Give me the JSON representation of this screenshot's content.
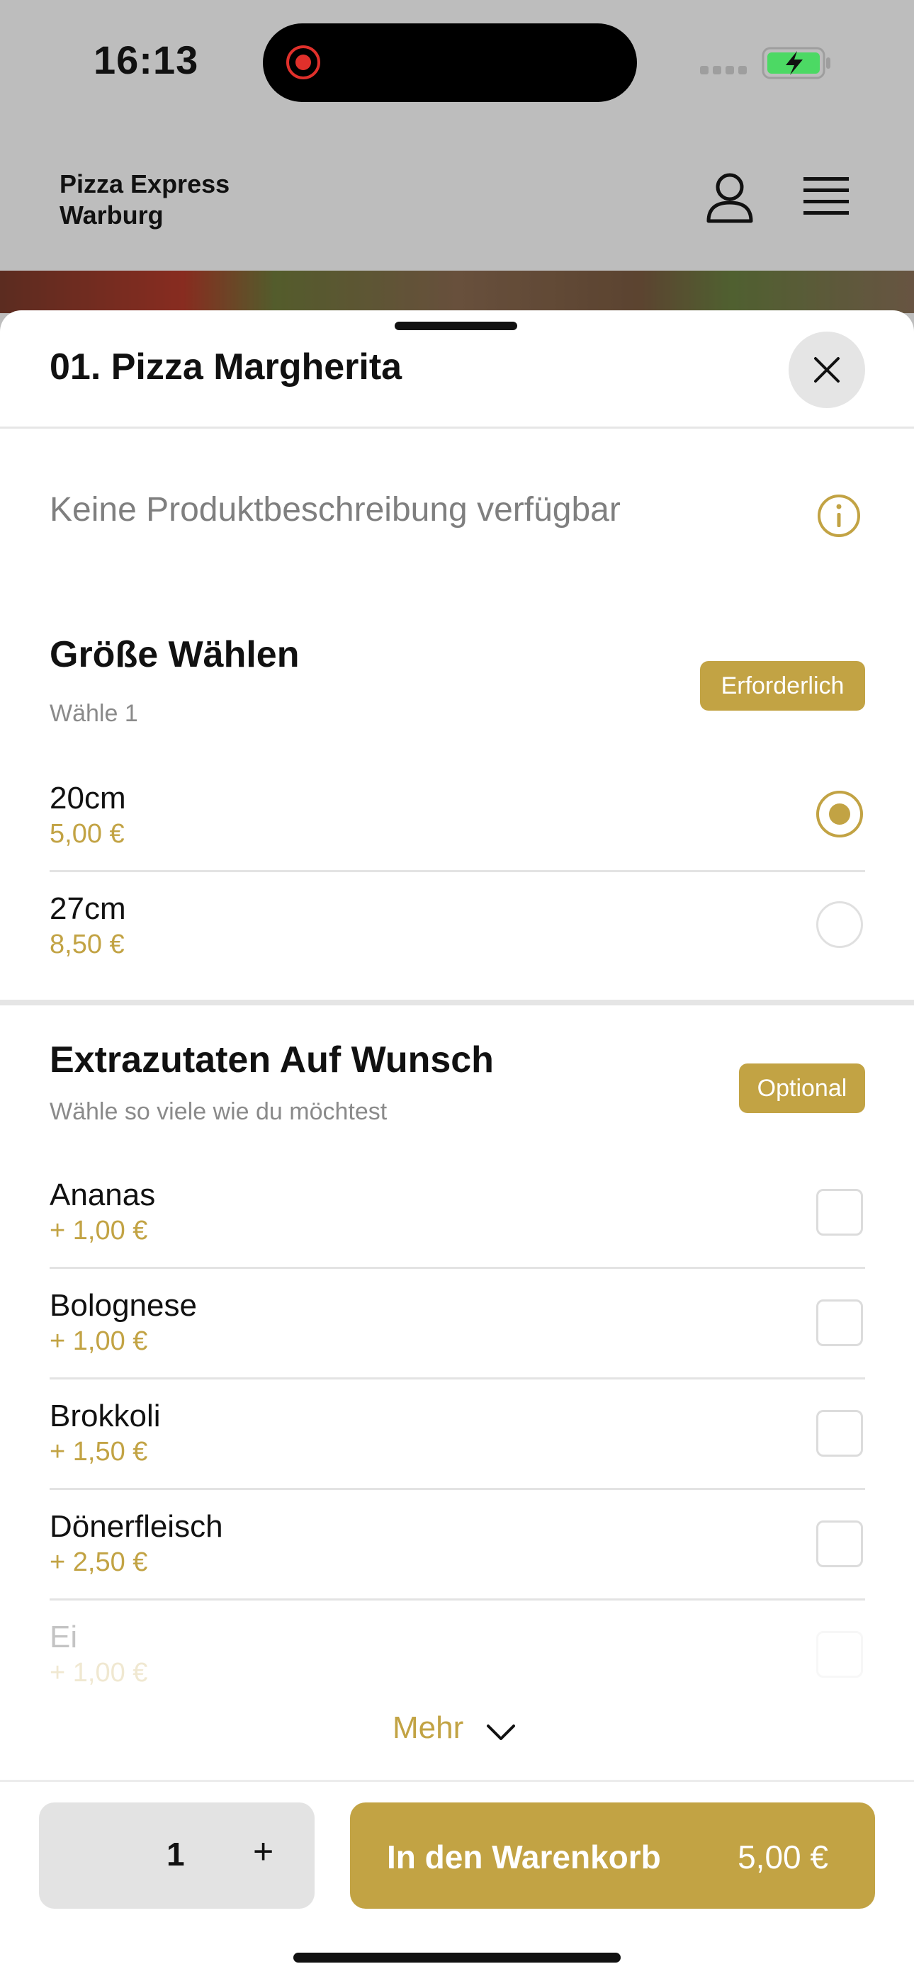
{
  "status_bar": {
    "time": "16:13"
  },
  "header": {
    "brand_line1": "Pizza Express",
    "brand_line2": "Warburg"
  },
  "sheet": {
    "title": "01. Pizza Margherita",
    "description": "Keine Produktbeschreibung verfügbar",
    "size_section": {
      "title": "Größe Wählen",
      "subtitle": "Wähle 1",
      "badge": "Erforderlich",
      "options": [
        {
          "name": "20cm",
          "price": "5,00 €",
          "selected": true
        },
        {
          "name": "27cm",
          "price": "8,50 €",
          "selected": false
        }
      ]
    },
    "extras_section": {
      "title": "Extrazutaten Auf Wunsch",
      "subtitle": "Wähle so viele wie du möchtest",
      "badge": "Optional",
      "options": [
        {
          "name": "Ananas",
          "price": "+ 1,00 €"
        },
        {
          "name": "Bolognese",
          "price": "+ 1,00 €"
        },
        {
          "name": "Brokkoli",
          "price": "+ 1,50 €"
        },
        {
          "name": "Dönerfleisch",
          "price": "+ 2,50 €"
        },
        {
          "name": "Ei",
          "price": "+ 1,00 €"
        }
      ]
    },
    "more_label": "Mehr"
  },
  "footer": {
    "quantity": "1",
    "plus": "+",
    "cart_label": "In den Warenkorb",
    "cart_price": "5,00 €"
  },
  "colors": {
    "accent": "#c2a344",
    "header_bg": "#bdbdbd"
  }
}
